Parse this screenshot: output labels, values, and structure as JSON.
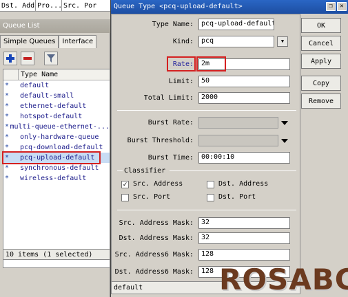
{
  "top_strip": {
    "cols": [
      "Dst. Add...",
      "Pro...",
      "Src. Por"
    ]
  },
  "queue_list": {
    "title": "Queue List",
    "tabs": [
      "Simple Queues",
      "Interface"
    ],
    "column_header": "Type Name",
    "items": [
      {
        "name": "default",
        "selected": false
      },
      {
        "name": "default-small",
        "selected": false
      },
      {
        "name": "ethernet-default",
        "selected": false
      },
      {
        "name": "hotspot-default",
        "selected": false
      },
      {
        "name": "multi-queue-ethernet-...",
        "selected": false
      },
      {
        "name": "only-hardware-queue",
        "selected": false
      },
      {
        "name": "pcq-download-default",
        "selected": false
      },
      {
        "name": "pcq-upload-default",
        "selected": true
      },
      {
        "name": "synchronous-default",
        "selected": false
      },
      {
        "name": "wireless-default",
        "selected": false
      }
    ],
    "marker": "*",
    "status": "10 items (1 selected)"
  },
  "dialog": {
    "title": "Queue Type <pcq-upload-default>",
    "fields": {
      "type_name": {
        "label": "Type Name:",
        "value": "pcq-upload-default"
      },
      "kind": {
        "label": "Kind:",
        "value": "pcq"
      },
      "rate": {
        "label": "Rate:",
        "value": "2m"
      },
      "limit": {
        "label": "Limit:",
        "value": "50"
      },
      "total_limit": {
        "label": "Total Limit:",
        "value": "2000"
      },
      "burst_rate": {
        "label": "Burst Rate:",
        "value": ""
      },
      "burst_threshold": {
        "label": "Burst Threshold:",
        "value": ""
      },
      "burst_time": {
        "label": "Burst Time:",
        "value": "00:00:10"
      }
    },
    "classifier": {
      "label": "Classifier",
      "src_address": {
        "label": "Src. Address",
        "checked": true
      },
      "dst_address": {
        "label": "Dst. Address",
        "checked": false
      },
      "src_port": {
        "label": "Src. Port",
        "checked": false
      },
      "dst_port": {
        "label": "Dst. Port",
        "checked": false
      }
    },
    "masks": {
      "src_address_mask": {
        "label": "Src. Address Mask:",
        "value": "32"
      },
      "dst_address_mask": {
        "label": "Dst. Address Mask:",
        "value": "32"
      },
      "src_address6_mask": {
        "label": "Src. Address6 Mask:",
        "value": "128"
      },
      "dst_address6_mask": {
        "label": "Dst. Address6 Mask:",
        "value": "128"
      }
    },
    "buttons": {
      "ok": "OK",
      "cancel": "Cancel",
      "apply": "Apply",
      "copy": "Copy",
      "remove": "Remove"
    },
    "footer": "default"
  },
  "watermark": "ROSABC",
  "colors": {
    "title_bar": "#1d4ea2",
    "highlight": "#d42020",
    "watermark": "#6b3a1f"
  }
}
